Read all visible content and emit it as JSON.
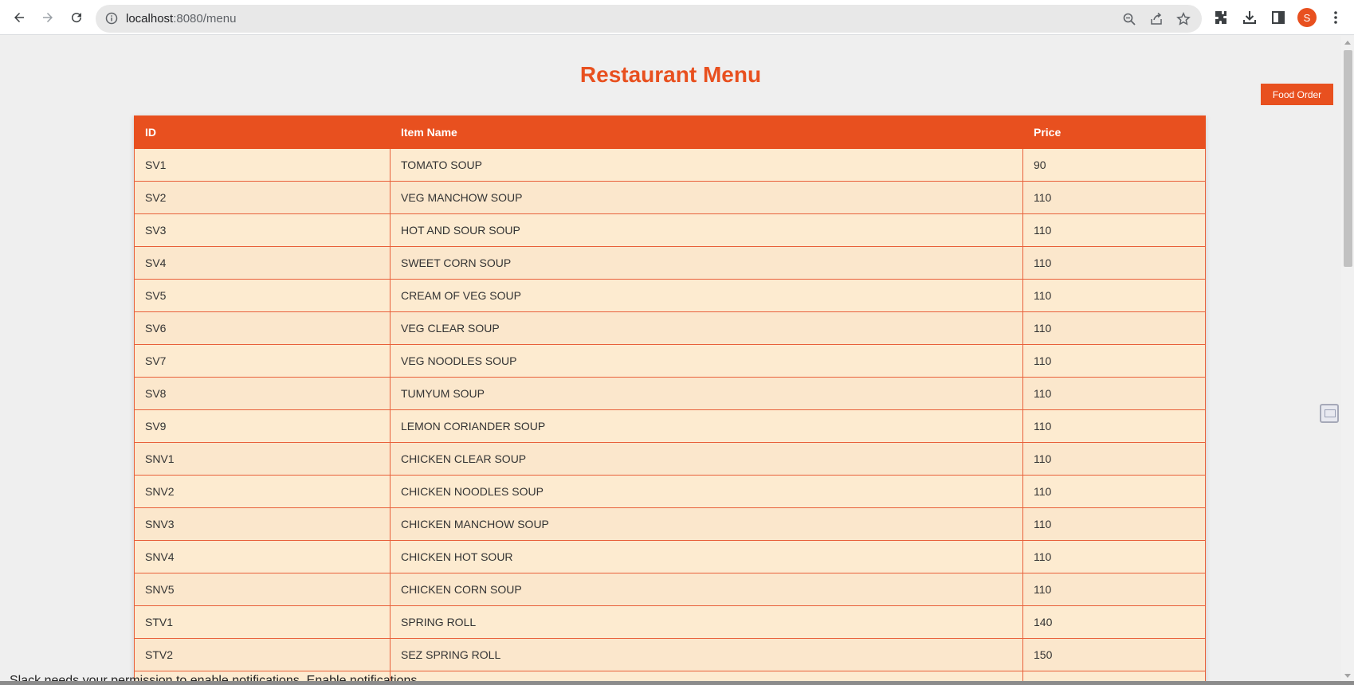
{
  "browser": {
    "url_host": "localhost",
    "url_path": ":8080/menu",
    "avatar_letter": "S"
  },
  "page": {
    "title": "Restaurant Menu",
    "order_button": "Food Order"
  },
  "table": {
    "headers": [
      "ID",
      "Item Name",
      "Price"
    ],
    "rows": [
      [
        "SV1",
        "TOMATO SOUP",
        "90"
      ],
      [
        "SV2",
        "VEG MANCHOW SOUP",
        "110"
      ],
      [
        "SV3",
        "HOT AND SOUR SOUP",
        "110"
      ],
      [
        "SV4",
        "SWEET CORN SOUP",
        "110"
      ],
      [
        "SV5",
        "CREAM OF VEG SOUP",
        "110"
      ],
      [
        "SV6",
        "VEG CLEAR SOUP",
        "110"
      ],
      [
        "SV7",
        "VEG NOODLES SOUP",
        "110"
      ],
      [
        "SV8",
        "TUMYUM SOUP",
        "110"
      ],
      [
        "SV9",
        "LEMON CORIANDER SOUP",
        "110"
      ],
      [
        "SNV1",
        "CHICKEN CLEAR SOUP",
        "110"
      ],
      [
        "SNV2",
        "CHICKEN NOODLES SOUP",
        "110"
      ],
      [
        "SNV3",
        "CHICKEN MANCHOW SOUP",
        "110"
      ],
      [
        "SNV4",
        "CHICKEN HOT SOUR",
        "110"
      ],
      [
        "SNV5",
        "CHICKEN CORN SOUP",
        "110"
      ],
      [
        "STV1",
        "SPRING ROLL",
        "140"
      ],
      [
        "STV2",
        "SEZ SPRING ROLL",
        "150"
      ],
      [
        "",
        "",
        ""
      ]
    ]
  },
  "notification": {
    "text": "Slack needs your permission to enable notifications. Enable notifications"
  },
  "colors": {
    "accent": "#e8501f",
    "row_bg": "#fdebd0"
  }
}
